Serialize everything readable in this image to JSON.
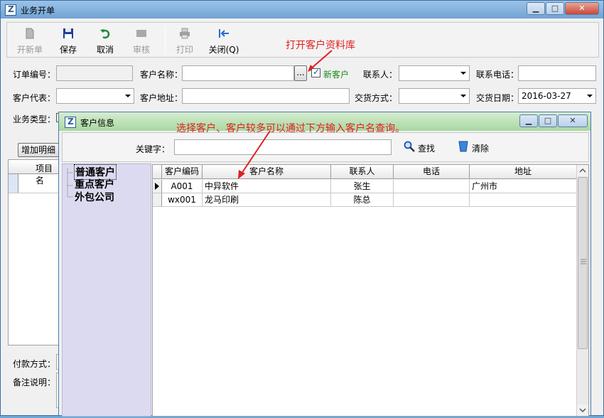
{
  "main_window": {
    "title": "业务开单",
    "caption_buttons": {
      "min": "▁",
      "max": "□",
      "close": "✕"
    }
  },
  "toolbar": {
    "new_label": "开新单",
    "save_label": "保存",
    "cancel_label": "取消",
    "audit_label": "审核",
    "print_label": "打印",
    "close_label": "关闭(Q)"
  },
  "form": {
    "order_no_label": "订单编号：",
    "order_no_value": "",
    "customer_name_label": "客户名称：",
    "customer_name_value": "",
    "browse_label": "...",
    "new_customer_label": "新客户",
    "contact_label": "联系人：",
    "phone_label": "联系电话：",
    "rep_label": "客户代表：",
    "address_label": "客户地址：",
    "delivery_method_label": "交货方式：",
    "delivery_date_label": "交货日期：",
    "delivery_date_value": "2016-03-27",
    "business_type_label": "业务类型：",
    "add_detail_label": "增加明细",
    "item_col_label": "项目名",
    "payment_label": "付款方式：",
    "remark_label": "备注说明："
  },
  "annotations": {
    "open_library": "打开客户资料库",
    "hint": "选择客户、客户较多可以通过下方输入客户名查询。"
  },
  "dialog": {
    "title": "客户信息",
    "keyword_label": "关键字：",
    "keyword_value": "",
    "find_label": "查找",
    "clear_label": "清除",
    "tree": [
      "普通客户",
      "重点客户",
      "外包公司"
    ],
    "columns": [
      "客户编码",
      "客户名称",
      "联系人",
      "电话",
      "地址"
    ],
    "rows": [
      {
        "code": "A001",
        "name": "中异软件",
        "contact": "张生",
        "phone": "",
        "address": "广州市"
      },
      {
        "code": "wx001",
        "name": "龙马印刷",
        "contact": "陈总",
        "phone": "",
        "address": ""
      }
    ]
  },
  "colors": {
    "annotation": "#e02020",
    "accent_blue": "#1a50b8",
    "new_customer_green": "#1a8a1a"
  },
  "icons": [
    "new-doc-icon",
    "save-disk-icon",
    "undo-icon",
    "audit-icon",
    "printer-icon",
    "exit-arrow-icon",
    "search-magnifier-icon",
    "clear-cup-icon"
  ]
}
